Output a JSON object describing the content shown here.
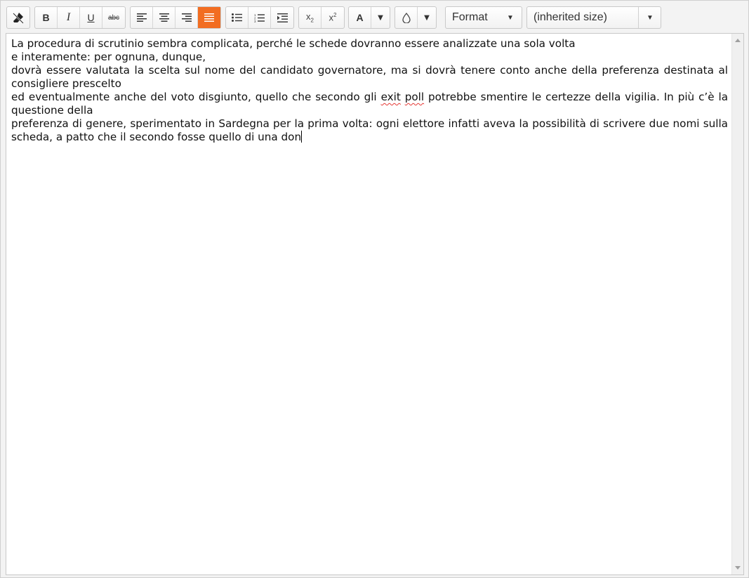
{
  "toolbar": {
    "bold_label": "B",
    "italic_label": "I",
    "underline_label": "U",
    "strike_label": "abc",
    "font_color_label": "A",
    "format_label": "Format",
    "size_label": "(inherited size)",
    "subscript_base": "x",
    "subscript_mark": "2",
    "superscript_base": "x",
    "superscript_mark": "2",
    "accent_color": "#f26d21"
  },
  "editor": {
    "paragraphs": [
      "La procedura di scrutinio sembra complicata, perché le schede dovranno essere analizzate una sola volta",
      "e interamente: per ognuna, dunque,",
      "dovrà essere valutata la scelta sul nome del candidato governatore, ma si dovrà tenere conto anche della preferenza destinata al consigliere prescelto",
      "ed eventualmente anche del voto disgiunto, quello che secondo gli ",
      "exit",
      " ",
      "poll",
      " potrebbe smentire le certezze della vigilia. In più c’è la questione della",
      "preferenza di genere, sperimentato in Sardegna per la prima volta: ogni elettore infatti aveva la possibilità di scrivere due nomi sulla scheda, a patto che il secondo fosse quello di una don"
    ]
  }
}
